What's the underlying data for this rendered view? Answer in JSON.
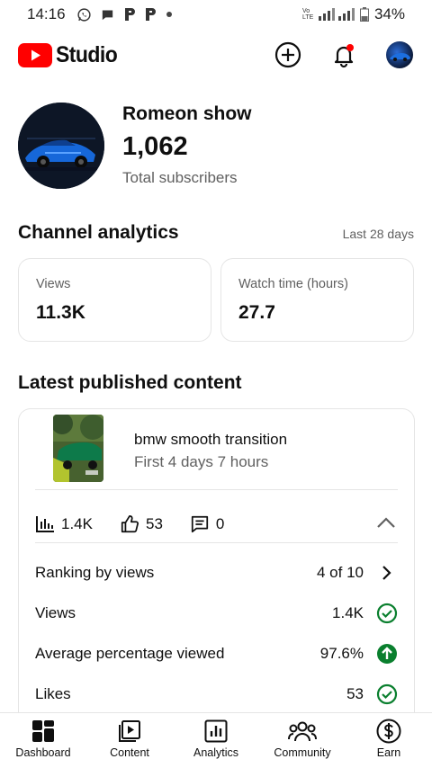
{
  "status_bar": {
    "time": "14:16",
    "network_label": "Vo LTE",
    "battery": "34%"
  },
  "app": {
    "logo_text": "Studio",
    "brand_color": "#ff0000"
  },
  "channel": {
    "name": "Romeon show",
    "subscribers": "1,062",
    "subscribers_label": "Total subscribers"
  },
  "analytics": {
    "title": "Channel analytics",
    "period": "Last 28 days",
    "metrics": [
      {
        "label": "Views",
        "value": "11.3K"
      },
      {
        "label": "Watch time (hours)",
        "value": "27.7"
      }
    ]
  },
  "latest": {
    "title": "Latest published content",
    "video": {
      "title": "bmw smooth transition",
      "subtitle": "First 4 days 7 hours"
    },
    "stats": {
      "views": "1.4K",
      "likes": "53",
      "comments": "0"
    },
    "rows": [
      {
        "label": "Ranking by views",
        "value": "4 of 10",
        "icon": "chevron-right-icon"
      },
      {
        "label": "Views",
        "value": "1.4K",
        "icon": "check-circle-icon"
      },
      {
        "label": "Average percentage viewed",
        "value": "97.6%",
        "icon": "arrow-up-circle-icon"
      },
      {
        "label": "Likes",
        "value": "53",
        "icon": "check-circle-icon"
      }
    ],
    "accent_green": "#0a7f2e"
  },
  "nav": {
    "items": [
      {
        "label": "Dashboard",
        "icon": "dashboard-icon"
      },
      {
        "label": "Content",
        "icon": "content-icon"
      },
      {
        "label": "Analytics",
        "icon": "analytics-icon"
      },
      {
        "label": "Community",
        "icon": "community-icon"
      },
      {
        "label": "Earn",
        "icon": "earn-icon"
      }
    ]
  }
}
